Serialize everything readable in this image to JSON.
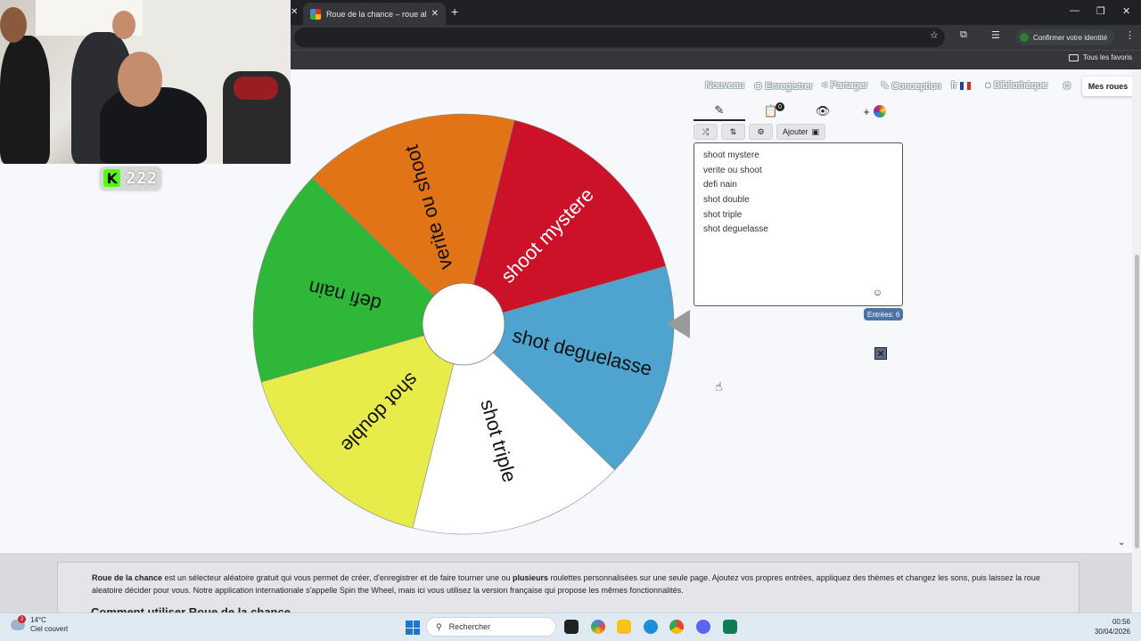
{
  "browser": {
    "tab_title": "Roue de la chance – roue aléatoire",
    "identity_label": "Confirmer votre identité",
    "bookmarks_folder": "Tous les favoris"
  },
  "stream": {
    "kick_viewers": "222"
  },
  "site_menu": {
    "nouveau": "Nouveau",
    "enregistrer": "Enregistrer",
    "partager": "Partager",
    "conception": "Conception",
    "langue": "fr",
    "bibliotheque": "Bibliothèque",
    "mes_roues": "Mes roues"
  },
  "wheel": {
    "segments": [
      {
        "label": "shoot mystere",
        "color": "#cc1228"
      },
      {
        "label": "shot deguelasse",
        "color": "#4fa3cf"
      },
      {
        "label": "shot triple",
        "color": "#ffffff"
      },
      {
        "label": "shot double",
        "color": "#e8ec4a"
      },
      {
        "label": "defi nain",
        "color": "#2fb838"
      },
      {
        "label": "verite ou shoot",
        "color": "#e07417"
      }
    ]
  },
  "editor": {
    "add_button": "Ajouter",
    "entries": [
      "shoot mystere",
      "verite ou shoot",
      "defi nain",
      "shot double",
      "shot triple",
      "shot deguelasse"
    ],
    "entries_count_label": "Entrées: 6",
    "badge_count": "0"
  },
  "description": {
    "brand": "Roue de la chance",
    "text_1": " est un sélecteur aléatoire gratuit qui vous permet de créer, d'enregistrer et de faire tourner une ou ",
    "bold_2": "plusieurs",
    "text_3": " roulettes personnalisées sur une seule page. Ajoutez vos propres entrées, appliquez des thèmes et changez les sons, puis laissez la roue aleatoire décider pour vous. Notre application internationale s'appelle Spin the Wheel, mais ici vous utilisez la version française qui propose les mêmes fonctionnalités.",
    "howto_title": "Comment utiliser Roue de la chance"
  },
  "taskbar": {
    "temperature": "14°C",
    "weather": "Ciel couvert",
    "weather_badge": "2",
    "search_placeholder": "Rechercher",
    "time": "00:56",
    "date": "30/04/2026"
  }
}
